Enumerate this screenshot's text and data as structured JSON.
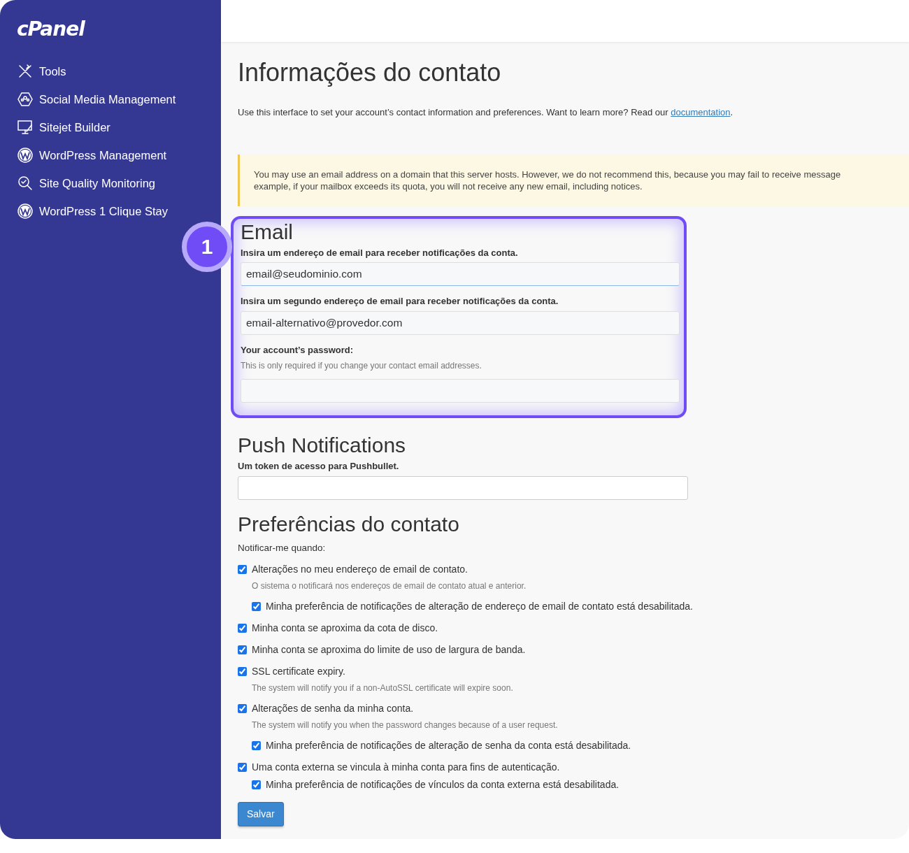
{
  "sidebar": {
    "logo": "cPanel",
    "items": [
      {
        "label": "Tools"
      },
      {
        "label": "Social Media Management"
      },
      {
        "label": "Sitejet Builder"
      },
      {
        "label": "WordPress Management"
      },
      {
        "label": "Site Quality Monitoring"
      },
      {
        "label": "WordPress 1 Clique Stay"
      }
    ]
  },
  "page": {
    "title": "Informações do contato",
    "intro": "Use this interface to set your account’s contact information and preferences. Want to learn more? Read our",
    "intro_link": "documentation",
    "intro_end": "."
  },
  "alert": {
    "lines": [
      "You may use an email address on a domain that this server hosts. However, we do not recommend this, because you may fail to receive message",
      "example, if your mailbox exceeds its quota, you will not receive any new email, including notices."
    ]
  },
  "callout": {
    "number": "1"
  },
  "email": {
    "title": "Email",
    "fields": [
      {
        "label": "Insira um endereço de email para receber notificações da conta.",
        "value": "email@seudominio.com"
      },
      {
        "label": "Insira um segundo endereço de email para receber notificações da conta.",
        "value": "email-alternativo@provedor.com"
      },
      {
        "label": "Your account’s password:",
        "help": "This is only required if you change your contact email addresses."
      }
    ]
  },
  "push": {
    "title": "Push Notifications",
    "label": "Um token de acesso para Pushbullet."
  },
  "preferences": {
    "title": "Preferências do contato",
    "lead": "Notificar-me quando:",
    "items": [
      {
        "label": "Alterações no meu endereço de email de contato.",
        "checked": true,
        "note": "O sistema o notificará nos endereços de email de contato atual e anterior.",
        "children": [
          {
            "label": "Minha preferência de notificações de alteração de endereço de email de contato está desabilitada.",
            "checked": true
          }
        ]
      },
      {
        "label": "Minha conta se aproxima da cota de disco.",
        "checked": true
      },
      {
        "label": "Minha conta se aproxima do limite de uso de largura de banda.",
        "checked": true
      },
      {
        "label": "SSL certificate expiry.",
        "checked": true,
        "note": "The system will notify you if a non-AutoSSL certificate will expire soon."
      },
      {
        "label": "Alterações de senha da minha conta.",
        "checked": true,
        "note": "The system will notify you when the password changes because of a user request.",
        "children": [
          {
            "label": "Minha preferência de notificações de alteração de senha da conta está desabilitada.",
            "checked": true
          }
        ]
      },
      {
        "label": "Uma conta externa se vincula à minha conta para fins de autenticação.",
        "checked": true,
        "children": [
          {
            "label": "Minha preferência de notificações de vínculos da conta externa está desabilitada.",
            "checked": true
          }
        ]
      }
    ]
  },
  "save_button": "Salvar"
}
